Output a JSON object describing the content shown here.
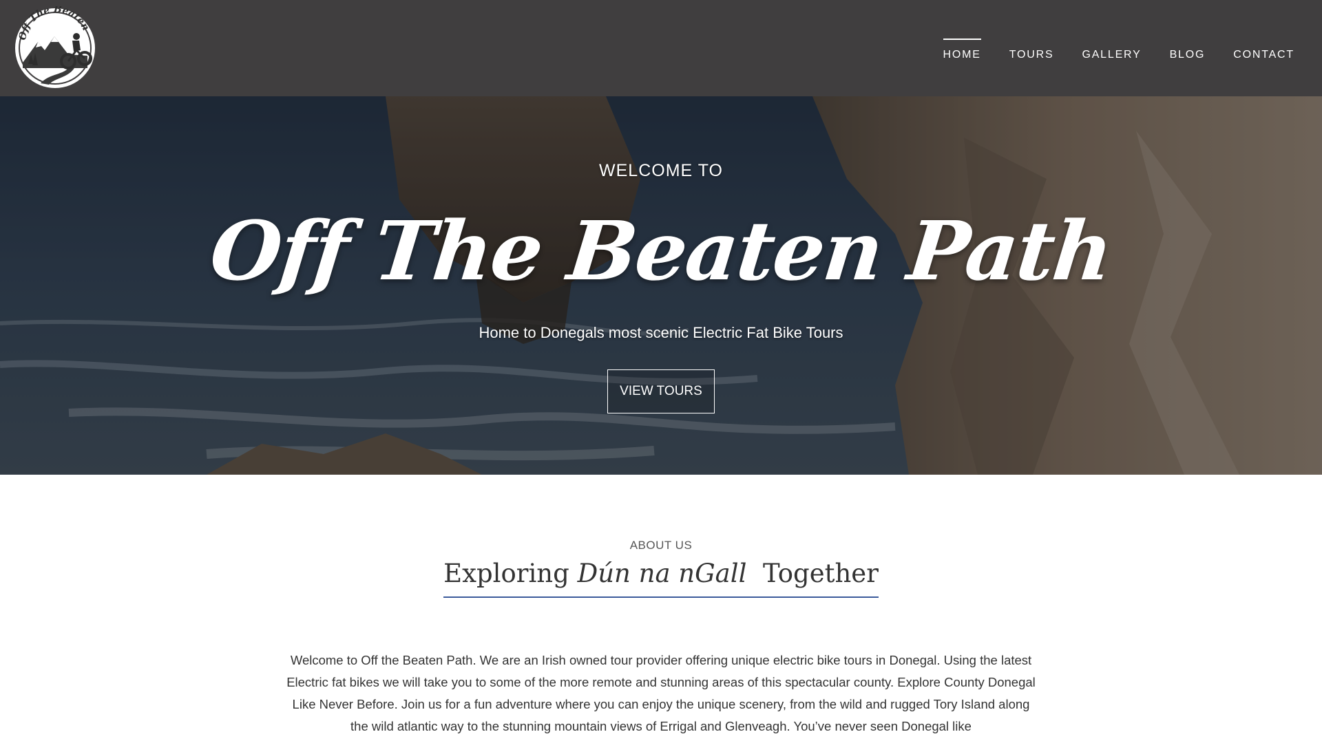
{
  "brand": {
    "logo_text": "Off The Beaten Path",
    "logo_alt": "Off The Beaten Path logo"
  },
  "nav": {
    "items": [
      {
        "label": "HOME",
        "active": true
      },
      {
        "label": "TOURS",
        "active": false
      },
      {
        "label": "GALLERY",
        "active": false
      },
      {
        "label": "BLOG",
        "active": false
      },
      {
        "label": "CONTACT",
        "active": false
      }
    ]
  },
  "hero": {
    "welcome": "WELCOME  TO",
    "title": "Off The Beaten Path",
    "subtitle": "Home to Donegals most scenic Electric Fat Bike Tours",
    "button_label": "VIEW TOURS"
  },
  "about": {
    "eyebrow": "ABOUT US",
    "heading_pre": "Exploring ",
    "heading_irish": "Dún na nGall",
    "heading_post": "  Together",
    "body": "Welcome to Off the Beaten Path. We are an Irish owned tour provider offering unique electric bike tours in Donegal. Using the latest Electric fat bikes we will take you to some of the more remote and stunning areas of this spectacular county. Explore County Donegal Like Never Before. Join us for a fun adventure where you can enjoy the unique scenery, from the wild and rugged Tory Island along the wild atlantic way to the stunning mountain views of Errigal and Glenveagh. You’ve never seen Donegal like"
  },
  "colors": {
    "header_bg": "#403e3f",
    "accent_underline": "#3b5a9a",
    "text_dark": "#333333"
  }
}
